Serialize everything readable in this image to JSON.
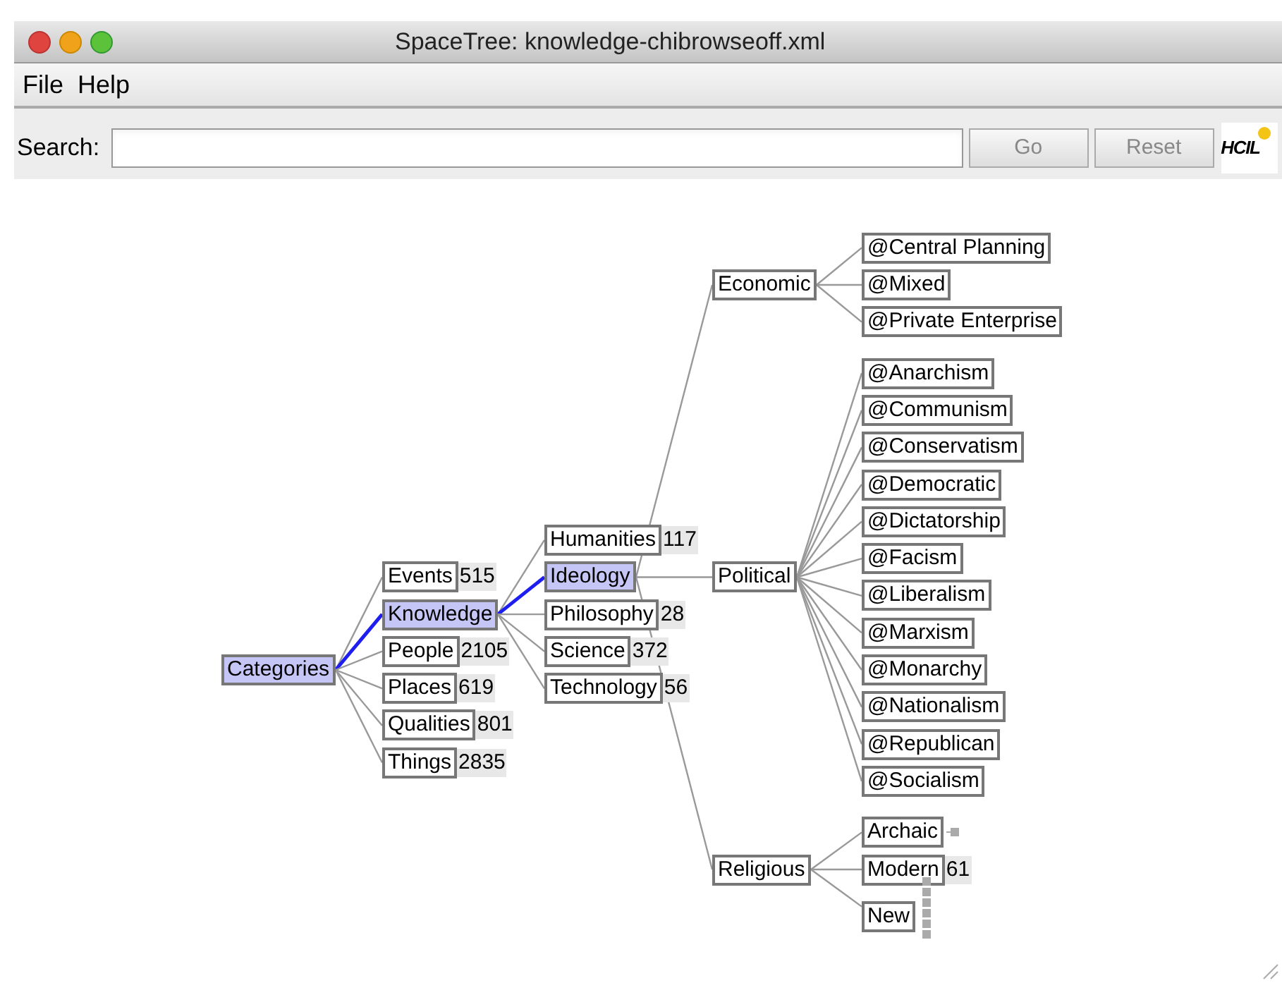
{
  "window": {
    "title": "SpaceTree: knowledge-chibrowseoff.xml"
  },
  "menu": [
    "File",
    "Help"
  ],
  "search": {
    "label": "Search:",
    "buttons": [
      "Go",
      "Reset"
    ]
  },
  "logo": "HCIL",
  "tree": {
    "label": "Categories",
    "selected": true,
    "children": [
      {
        "label": "Events",
        "count": "515",
        "selected": false
      },
      {
        "label": "Knowledge",
        "selected": true,
        "children": [
          {
            "label": "Humanities",
            "count": "117",
            "selected": false
          },
          {
            "label": "Ideology",
            "selected": true,
            "children": [
              {
                "label": "Economic",
                "selected": false,
                "children": [
                  {
                    "label": "@Central Planning",
                    "selected": false
                  },
                  {
                    "label": "@Mixed",
                    "selected": false
                  },
                  {
                    "label": "@Private Enterprise",
                    "selected": false
                  }
                ]
              },
              {
                "label": "Political",
                "selected": false,
                "children": [
                  {
                    "label": "@Anarchism",
                    "selected": false
                  },
                  {
                    "label": "@Communism",
                    "selected": false
                  },
                  {
                    "label": "@Conservatism",
                    "selected": false
                  },
                  {
                    "label": "@Democratic",
                    "selected": false
                  },
                  {
                    "label": "@Dictatorship",
                    "selected": false
                  },
                  {
                    "label": "@Facism",
                    "selected": false
                  },
                  {
                    "label": "@Liberalism",
                    "selected": false
                  },
                  {
                    "label": "@Marxism",
                    "selected": false
                  },
                  {
                    "label": "@Monarchy",
                    "selected": false
                  },
                  {
                    "label": "@Nationalism",
                    "selected": false
                  },
                  {
                    "label": "@Republican",
                    "selected": false
                  },
                  {
                    "label": "@Socialism",
                    "selected": false
                  }
                ]
              },
              {
                "label": "Religious",
                "selected": false,
                "children": [
                  {
                    "label": "Archaic",
                    "selected": false,
                    "kind": "single"
                  },
                  {
                    "label": "Modern",
                    "count": "61",
                    "selected": false
                  },
                  {
                    "label": "New",
                    "selected": false,
                    "kind": "stacked"
                  }
                ]
              }
            ]
          },
          {
            "label": "Philosophy",
            "count": "28",
            "selected": false
          },
          {
            "label": "Science",
            "count": "372",
            "selected": false
          },
          {
            "label": "Technology",
            "count": "56",
            "selected": false
          }
        ]
      },
      {
        "label": "People",
        "count": "2105",
        "selected": false
      },
      {
        "label": "Places",
        "count": "619",
        "selected": false
      },
      {
        "label": "Qualities",
        "count": "801",
        "selected": false
      },
      {
        "label": "Things",
        "count": "2835",
        "selected": false
      }
    ]
  }
}
